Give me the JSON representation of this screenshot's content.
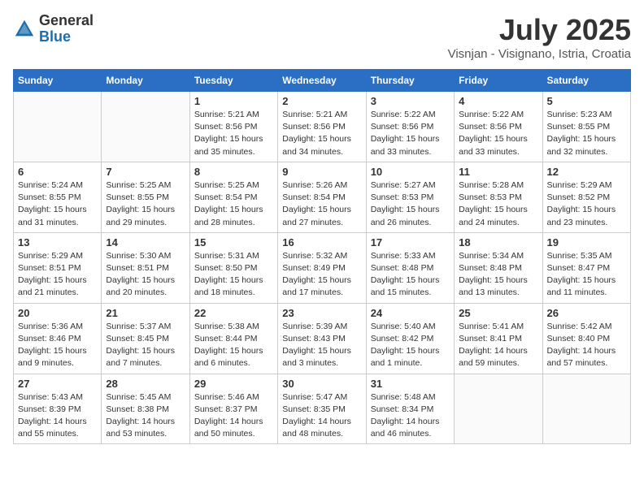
{
  "header": {
    "logo_general": "General",
    "logo_blue": "Blue",
    "month_title": "July 2025",
    "subtitle": "Visnjan - Visignano, Istria, Croatia"
  },
  "days_of_week": [
    "Sunday",
    "Monday",
    "Tuesday",
    "Wednesday",
    "Thursday",
    "Friday",
    "Saturday"
  ],
  "weeks": [
    [
      {
        "day": "",
        "detail": ""
      },
      {
        "day": "",
        "detail": ""
      },
      {
        "day": "1",
        "detail": "Sunrise: 5:21 AM\nSunset: 8:56 PM\nDaylight: 15 hours\nand 35 minutes."
      },
      {
        "day": "2",
        "detail": "Sunrise: 5:21 AM\nSunset: 8:56 PM\nDaylight: 15 hours\nand 34 minutes."
      },
      {
        "day": "3",
        "detail": "Sunrise: 5:22 AM\nSunset: 8:56 PM\nDaylight: 15 hours\nand 33 minutes."
      },
      {
        "day": "4",
        "detail": "Sunrise: 5:22 AM\nSunset: 8:56 PM\nDaylight: 15 hours\nand 33 minutes."
      },
      {
        "day": "5",
        "detail": "Sunrise: 5:23 AM\nSunset: 8:55 PM\nDaylight: 15 hours\nand 32 minutes."
      }
    ],
    [
      {
        "day": "6",
        "detail": "Sunrise: 5:24 AM\nSunset: 8:55 PM\nDaylight: 15 hours\nand 31 minutes."
      },
      {
        "day": "7",
        "detail": "Sunrise: 5:25 AM\nSunset: 8:55 PM\nDaylight: 15 hours\nand 29 minutes."
      },
      {
        "day": "8",
        "detail": "Sunrise: 5:25 AM\nSunset: 8:54 PM\nDaylight: 15 hours\nand 28 minutes."
      },
      {
        "day": "9",
        "detail": "Sunrise: 5:26 AM\nSunset: 8:54 PM\nDaylight: 15 hours\nand 27 minutes."
      },
      {
        "day": "10",
        "detail": "Sunrise: 5:27 AM\nSunset: 8:53 PM\nDaylight: 15 hours\nand 26 minutes."
      },
      {
        "day": "11",
        "detail": "Sunrise: 5:28 AM\nSunset: 8:53 PM\nDaylight: 15 hours\nand 24 minutes."
      },
      {
        "day": "12",
        "detail": "Sunrise: 5:29 AM\nSunset: 8:52 PM\nDaylight: 15 hours\nand 23 minutes."
      }
    ],
    [
      {
        "day": "13",
        "detail": "Sunrise: 5:29 AM\nSunset: 8:51 PM\nDaylight: 15 hours\nand 21 minutes."
      },
      {
        "day": "14",
        "detail": "Sunrise: 5:30 AM\nSunset: 8:51 PM\nDaylight: 15 hours\nand 20 minutes."
      },
      {
        "day": "15",
        "detail": "Sunrise: 5:31 AM\nSunset: 8:50 PM\nDaylight: 15 hours\nand 18 minutes."
      },
      {
        "day": "16",
        "detail": "Sunrise: 5:32 AM\nSunset: 8:49 PM\nDaylight: 15 hours\nand 17 minutes."
      },
      {
        "day": "17",
        "detail": "Sunrise: 5:33 AM\nSunset: 8:48 PM\nDaylight: 15 hours\nand 15 minutes."
      },
      {
        "day": "18",
        "detail": "Sunrise: 5:34 AM\nSunset: 8:48 PM\nDaylight: 15 hours\nand 13 minutes."
      },
      {
        "day": "19",
        "detail": "Sunrise: 5:35 AM\nSunset: 8:47 PM\nDaylight: 15 hours\nand 11 minutes."
      }
    ],
    [
      {
        "day": "20",
        "detail": "Sunrise: 5:36 AM\nSunset: 8:46 PM\nDaylight: 15 hours\nand 9 minutes."
      },
      {
        "day": "21",
        "detail": "Sunrise: 5:37 AM\nSunset: 8:45 PM\nDaylight: 15 hours\nand 7 minutes."
      },
      {
        "day": "22",
        "detail": "Sunrise: 5:38 AM\nSunset: 8:44 PM\nDaylight: 15 hours\nand 6 minutes."
      },
      {
        "day": "23",
        "detail": "Sunrise: 5:39 AM\nSunset: 8:43 PM\nDaylight: 15 hours\nand 3 minutes."
      },
      {
        "day": "24",
        "detail": "Sunrise: 5:40 AM\nSunset: 8:42 PM\nDaylight: 15 hours\nand 1 minute."
      },
      {
        "day": "25",
        "detail": "Sunrise: 5:41 AM\nSunset: 8:41 PM\nDaylight: 14 hours\nand 59 minutes."
      },
      {
        "day": "26",
        "detail": "Sunrise: 5:42 AM\nSunset: 8:40 PM\nDaylight: 14 hours\nand 57 minutes."
      }
    ],
    [
      {
        "day": "27",
        "detail": "Sunrise: 5:43 AM\nSunset: 8:39 PM\nDaylight: 14 hours\nand 55 minutes."
      },
      {
        "day": "28",
        "detail": "Sunrise: 5:45 AM\nSunset: 8:38 PM\nDaylight: 14 hours\nand 53 minutes."
      },
      {
        "day": "29",
        "detail": "Sunrise: 5:46 AM\nSunset: 8:37 PM\nDaylight: 14 hours\nand 50 minutes."
      },
      {
        "day": "30",
        "detail": "Sunrise: 5:47 AM\nSunset: 8:35 PM\nDaylight: 14 hours\nand 48 minutes."
      },
      {
        "day": "31",
        "detail": "Sunrise: 5:48 AM\nSunset: 8:34 PM\nDaylight: 14 hours\nand 46 minutes."
      },
      {
        "day": "",
        "detail": ""
      },
      {
        "day": "",
        "detail": ""
      }
    ]
  ]
}
